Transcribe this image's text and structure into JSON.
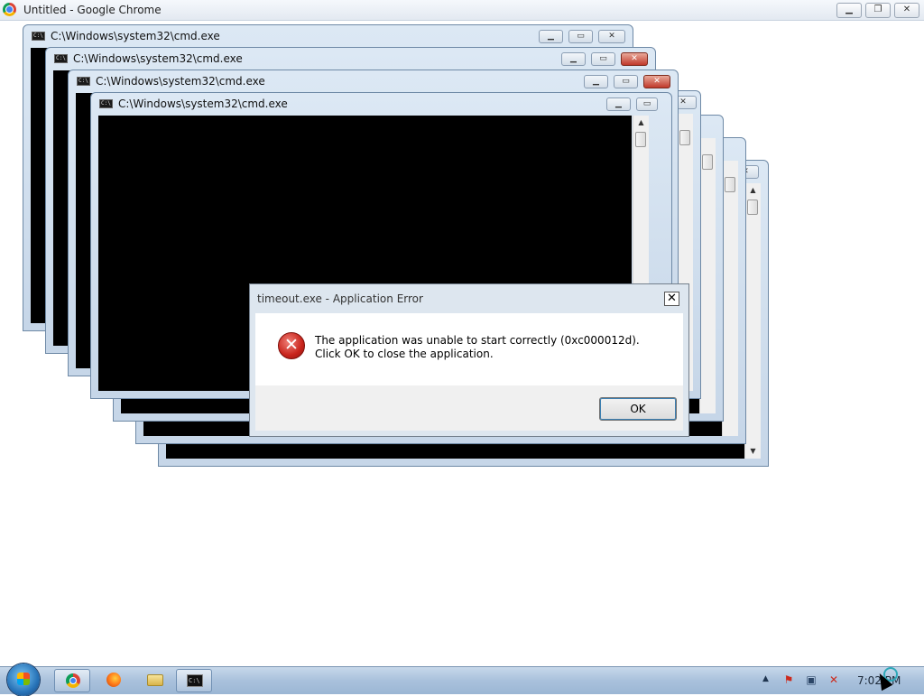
{
  "chrome": {
    "title": "Untitled - Google Chrome",
    "min_symbol": "▁",
    "max_symbol": "❐",
    "close_symbol": "✕",
    "icon": "chrome-icon"
  },
  "cmd_windows": [
    {
      "title": "C:\\Windows\\system32\\cmd.exe",
      "state": "inactive"
    },
    {
      "title": "C:\\Windows\\system32\\cmd.exe",
      "state": "inactive"
    },
    {
      "title": "C:\\Windows\\system32\\cmd.exe",
      "state": "active"
    },
    {
      "title": "C:\\Windows\\system32\\cmd.exe",
      "state": "inactive"
    }
  ],
  "cmd_icon_text": "C:\\",
  "window_buttons": {
    "min": "▁",
    "max": "▭",
    "close": "✕"
  },
  "dialog": {
    "title": "timeout.exe - Application Error",
    "close_symbol": "✕",
    "message": "The application was unable to start correctly (0xc000012d). Click OK to close the application.",
    "ok_label": "OK",
    "icon": "error-icon",
    "icon_glyph": "✕"
  },
  "taskbar": {
    "items": [
      "start-button",
      "chrome-icon",
      "firefox-icon",
      "explorer-icon",
      "cmd-icon"
    ],
    "tray_arrow": "▲",
    "tray_flag": "⚑",
    "tray_network": "▣",
    "tray_volume": "✕",
    "clock": "7:02 PM"
  },
  "colors": {
    "window_frame": "#c6d6e8",
    "console_bg": "#000000",
    "close_active": "#c0392b",
    "error_red": "#c8231b"
  }
}
